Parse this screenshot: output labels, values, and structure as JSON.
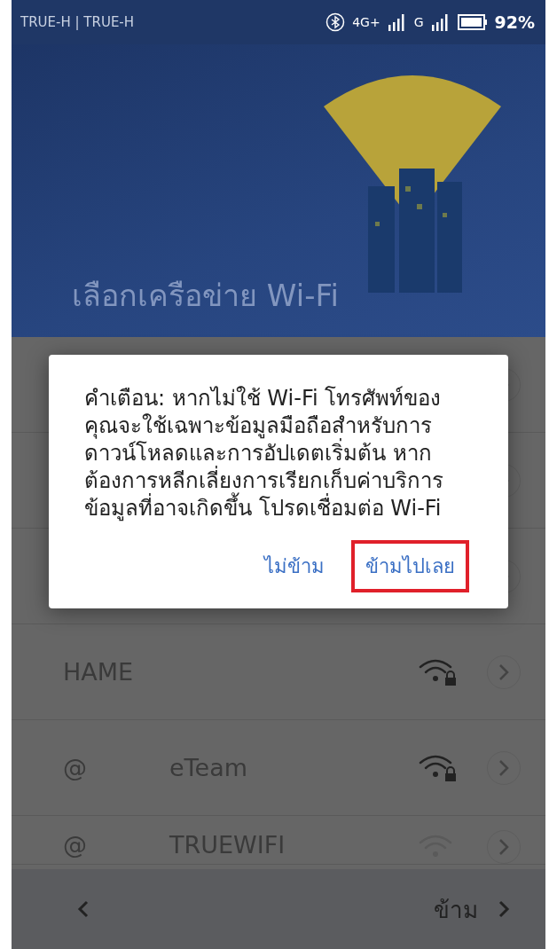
{
  "status_bar": {
    "carriers": "TRUE-H | TRUE-H",
    "network_type": "4G+",
    "second_network": "G",
    "battery": "92%"
  },
  "header": {
    "title": "เลือกเครือข่าย Wi-Fi"
  },
  "networks": [
    {
      "kind": "obscured"
    },
    {
      "kind": "obscured"
    },
    {
      "kind": "obscured"
    },
    {
      "kind": "network",
      "name": "HAME",
      "secured": true
    },
    {
      "kind": "network",
      "prefix": "@",
      "name": "eTeam",
      "secured": true
    },
    {
      "kind": "partial",
      "prefix": "@",
      "name": "TRUEWIFI",
      "secured": false
    }
  ],
  "dialog": {
    "message": "คำเตือน: หากไม่ใช้ Wi-Fi โทรศัพท์ของคุณจะใช้เฉพาะข้อมูลมือถือสำหรับการดาวน์โหลดและการอัปเดตเริ่มต้น หากต้องการหลีกเลี่ยงการเรียกเก็บค่าบริการข้อมูลที่อาจเกิดขึ้น โปรดเชื่อมต่อ Wi-Fi",
    "buttons": [
      {
        "label": "ไม่ข้าม",
        "highlighted": false
      },
      {
        "label": "ข้ามไปเลย",
        "highlighted": true
      }
    ]
  },
  "bottom_bar": {
    "skip": "ข้าม"
  }
}
